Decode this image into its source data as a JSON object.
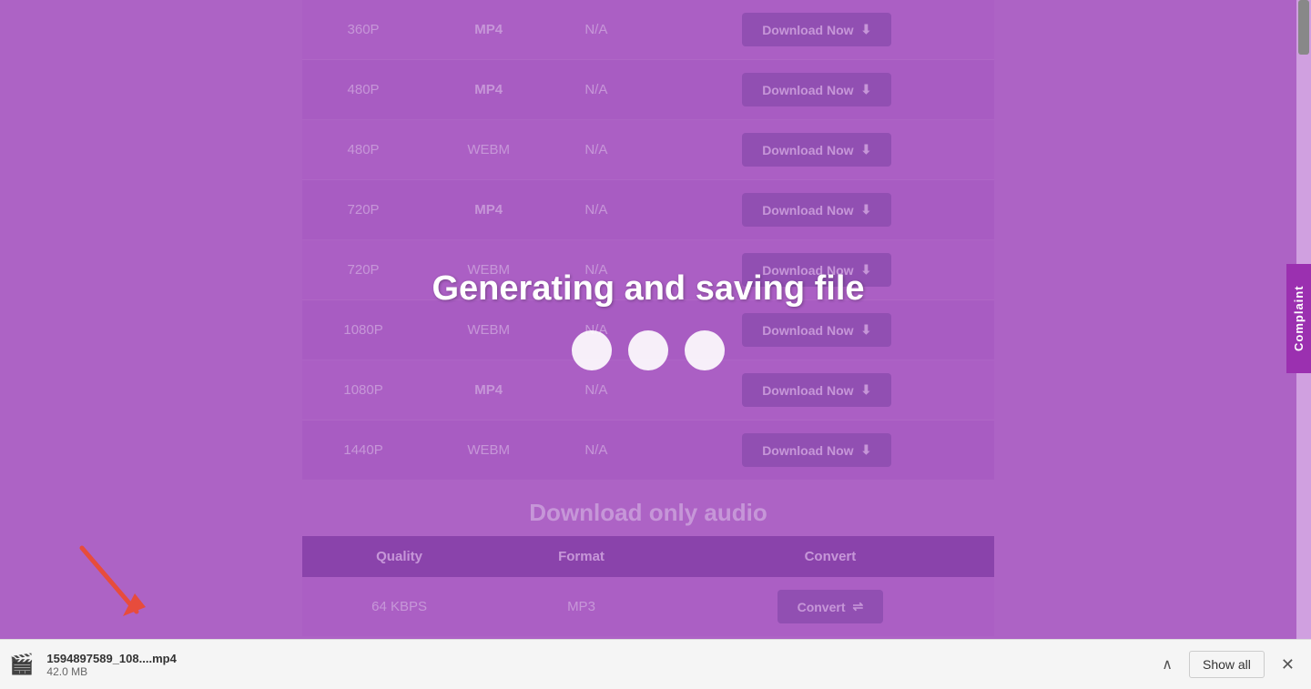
{
  "colors": {
    "bg": "#c07fcf",
    "button": "#7b4fa0",
    "header": "#6a3090",
    "overlay_bg": "rgba(160,80,190,0.6)"
  },
  "overlay": {
    "text": "Generating and saving file"
  },
  "video_rows": [
    {
      "quality": "360P",
      "format": "MP4",
      "format_type": "mp4",
      "size": "N/A"
    },
    {
      "quality": "480P",
      "format": "MP4",
      "format_type": "mp4",
      "size": "N/A"
    },
    {
      "quality": "480P",
      "format": "WEBM",
      "format_type": "webm",
      "size": "N/A"
    },
    {
      "quality": "720P",
      "format": "MP4",
      "format_type": "mp4",
      "size": "N/A"
    },
    {
      "quality": "720P",
      "format": "WEBM",
      "format_type": "webm",
      "size": "N/A"
    },
    {
      "quality": "1080P",
      "format": "WEBM",
      "format_type": "webm",
      "size": "N/A"
    },
    {
      "quality": "1080P",
      "format": "MP4",
      "format_type": "mp4",
      "size": "N/A"
    },
    {
      "quality": "1440P",
      "format": "WEBM",
      "format_type": "webm",
      "size": "N/A"
    }
  ],
  "download_btn_label": "Download Now",
  "download_icon": "⬇",
  "audio_section": {
    "title": "Download only audio",
    "headers": [
      "Quality",
      "Format",
      "Convert"
    ],
    "rows": [
      {
        "quality": "64 KBPS",
        "format": "MP3",
        "action": "Convert"
      }
    ]
  },
  "convert_icon": "⇌",
  "complaint_label": "Complaint",
  "download_bar": {
    "filename": "1594897589_108....mp4",
    "filesize": "42.0 MB",
    "show_all": "Show all",
    "expand_icon": "∧",
    "close_icon": "✕"
  }
}
